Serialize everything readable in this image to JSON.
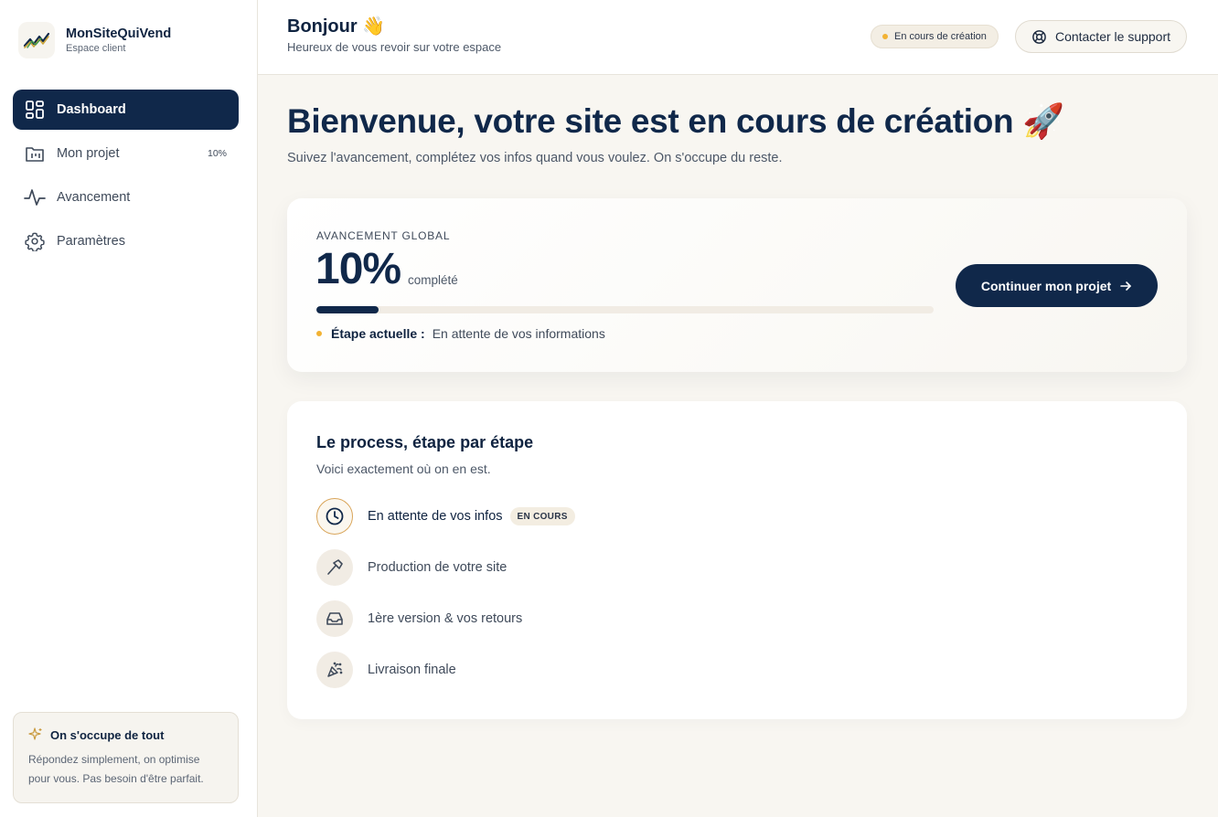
{
  "brand": {
    "name": "MonSiteQuiVend",
    "subtitle": "Espace client",
    "logo_icon": "trend-chart-icon"
  },
  "sidebar": {
    "items": [
      {
        "label": "Dashboard",
        "icon": "dashboard-icon",
        "active": true
      },
      {
        "label": "Mon projet",
        "icon": "folder-icon",
        "badge": "10%"
      },
      {
        "label": "Avancement",
        "icon": "activity-icon"
      },
      {
        "label": "Paramètres",
        "icon": "gear-icon"
      }
    ],
    "help": {
      "title": "On s'occupe de tout",
      "text": "Répondez simplement, on optimise pour vous. Pas besoin d'être parfait.",
      "icon": "sparkles-icon"
    }
  },
  "header": {
    "greeting": "Bonjour 👋",
    "subtitle": "Heureux de vous revoir sur votre espace",
    "status": "En cours de création",
    "status_color": "#f2b233",
    "support_label": "Contacter le support",
    "support_icon": "lifebuoy-icon"
  },
  "main": {
    "title": "Bienvenue, votre site est en cours de création 🚀",
    "subtitle": "Suivez l'avancement, complétez vos infos quand vous voulez. On s'occupe du reste."
  },
  "progress": {
    "label": "AVANCEMENT GLOBAL",
    "value": "10%",
    "fraction": 0.1,
    "unit": "complété",
    "step_key": "Étape actuelle :",
    "step_value": "En attente de vos informations",
    "cta_label": "Continuer mon projet",
    "accent": "#10284a"
  },
  "process": {
    "title": "Le process, étape par étape",
    "subtitle": "Voici exactement où on en est.",
    "steps": [
      {
        "label": "En attente de vos infos",
        "tag": "EN COURS",
        "icon": "clock-icon"
      },
      {
        "label": "Production de votre site",
        "icon": "hammer-icon"
      },
      {
        "label": "1ère version & vos retours",
        "icon": "inbox-icon"
      },
      {
        "label": "Livraison finale",
        "icon": "party-popper-icon"
      }
    ]
  }
}
